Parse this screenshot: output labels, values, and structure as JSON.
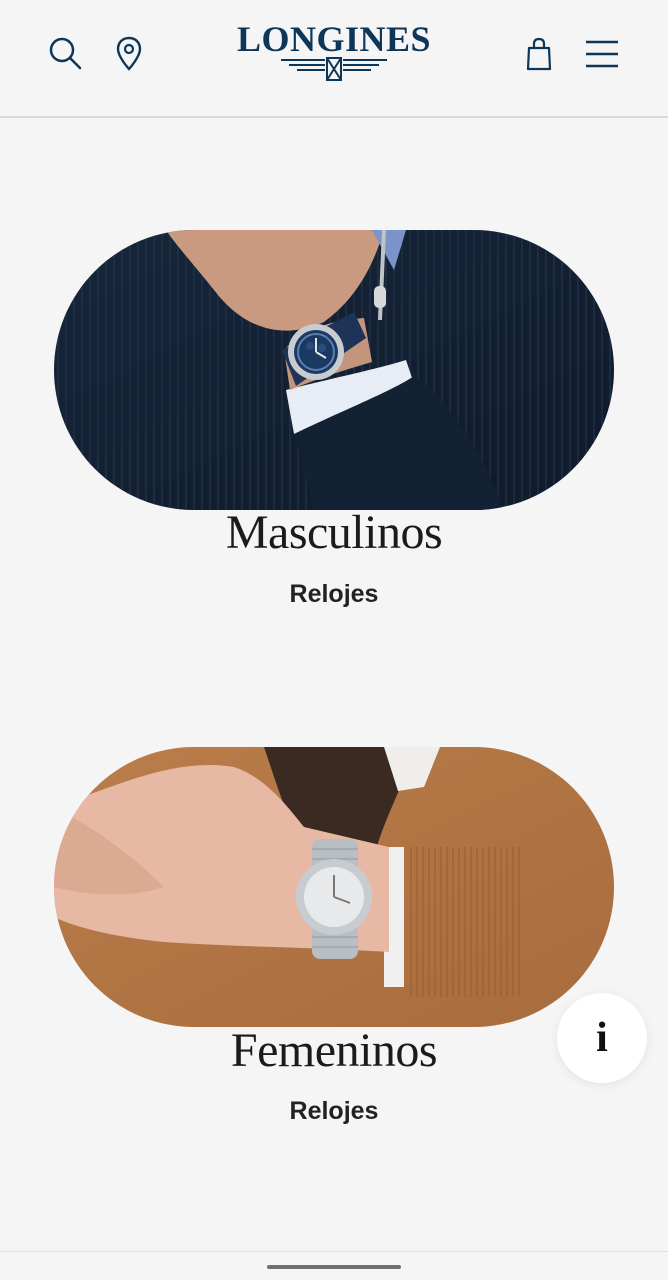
{
  "header": {
    "brand": "LONGINES",
    "icons": {
      "search": "search-icon",
      "location": "location-pin-icon",
      "bag": "shopping-bag-icon",
      "menu": "hamburger-menu-icon"
    },
    "brand_color": "#0d3658"
  },
  "categories": [
    {
      "title": "Masculinos",
      "subtitle": "Relojes"
    },
    {
      "title": "Femeninos",
      "subtitle": "Relojes"
    }
  ],
  "info_button": {
    "label": "i"
  }
}
